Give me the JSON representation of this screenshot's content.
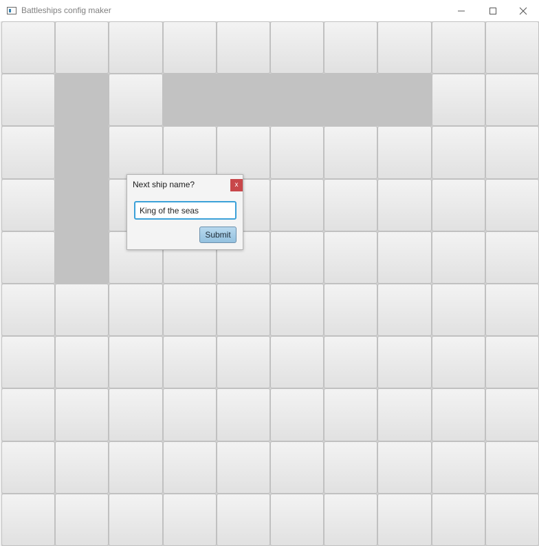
{
  "window": {
    "title": "Battleships config maker",
    "icon": "app-window-icon",
    "controls": [
      "minimize-icon",
      "maximize-icon",
      "close-icon"
    ]
  },
  "board": {
    "rows": 10,
    "cols": 10,
    "ship_cells": [
      [
        1,
        1
      ],
      [
        2,
        1
      ],
      [
        3,
        1
      ],
      [
        4,
        1
      ],
      [
        1,
        3
      ],
      [
        1,
        4
      ],
      [
        1,
        5
      ],
      [
        1,
        6
      ],
      [
        1,
        7
      ]
    ],
    "colors": {
      "cell": "#e9e9e9",
      "ship": "#c2c2c2",
      "cell_border": "#c0c0c0"
    }
  },
  "dialog": {
    "title": "Next ship name?",
    "close_label": "x",
    "input_value": "King of the seas",
    "submit_label": "Submit",
    "colors": {
      "close": "#c8474a",
      "focus_border": "#3aa0d8",
      "submit": "#a6cde7"
    }
  }
}
